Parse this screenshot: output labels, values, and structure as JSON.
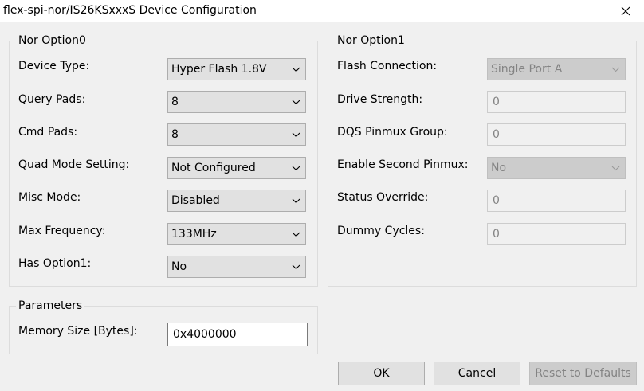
{
  "window": {
    "title": "flex-spi-nor/IS26KSxxxS Device Configuration"
  },
  "nor_option0": {
    "title": "Nor Option0",
    "fields": [
      {
        "label": "Device Type:",
        "value": "Hyper Flash 1.8V"
      },
      {
        "label": "Query Pads:",
        "value": "8"
      },
      {
        "label": "Cmd Pads:",
        "value": "8"
      },
      {
        "label": "Quad Mode Setting:",
        "value": "Not Configured"
      },
      {
        "label": "Misc Mode:",
        "value": "Disabled"
      },
      {
        "label": "Max Frequency:",
        "value": "133MHz"
      },
      {
        "label": "Has Option1:",
        "value": "No"
      }
    ]
  },
  "nor_option1": {
    "title": "Nor Option1",
    "fields": [
      {
        "label": "Flash Connection:",
        "value": "Single Port A",
        "control": "combo",
        "enabled": false
      },
      {
        "label": "Drive Strength:",
        "value": "0",
        "control": "text",
        "enabled": false
      },
      {
        "label": "DQS Pinmux Group:",
        "value": "0",
        "control": "text",
        "enabled": false
      },
      {
        "label": "Enable Second Pinmux:",
        "value": "No",
        "control": "combo",
        "enabled": false
      },
      {
        "label": "Status Override:",
        "value": "0",
        "control": "text",
        "enabled": false
      },
      {
        "label": "Dummy Cycles:",
        "value": "0",
        "control": "text",
        "enabled": false
      }
    ]
  },
  "parameters": {
    "title": "Parameters",
    "memory_size_label": "Memory Size [Bytes]:",
    "memory_size_value": "0x4000000"
  },
  "buttons": {
    "ok": "OK",
    "cancel": "Cancel",
    "reset": "Reset to Defaults",
    "reset_enabled": false
  },
  "icons": {
    "close": "close-icon",
    "dropdown": "chevron-down-icon"
  },
  "colors": {
    "window_bg": "#f0f0f0",
    "titlebar_bg": "#ffffff",
    "button_bg": "#e1e1e1",
    "disabled_bg": "#cccccc",
    "disabled_text": "#838383"
  }
}
